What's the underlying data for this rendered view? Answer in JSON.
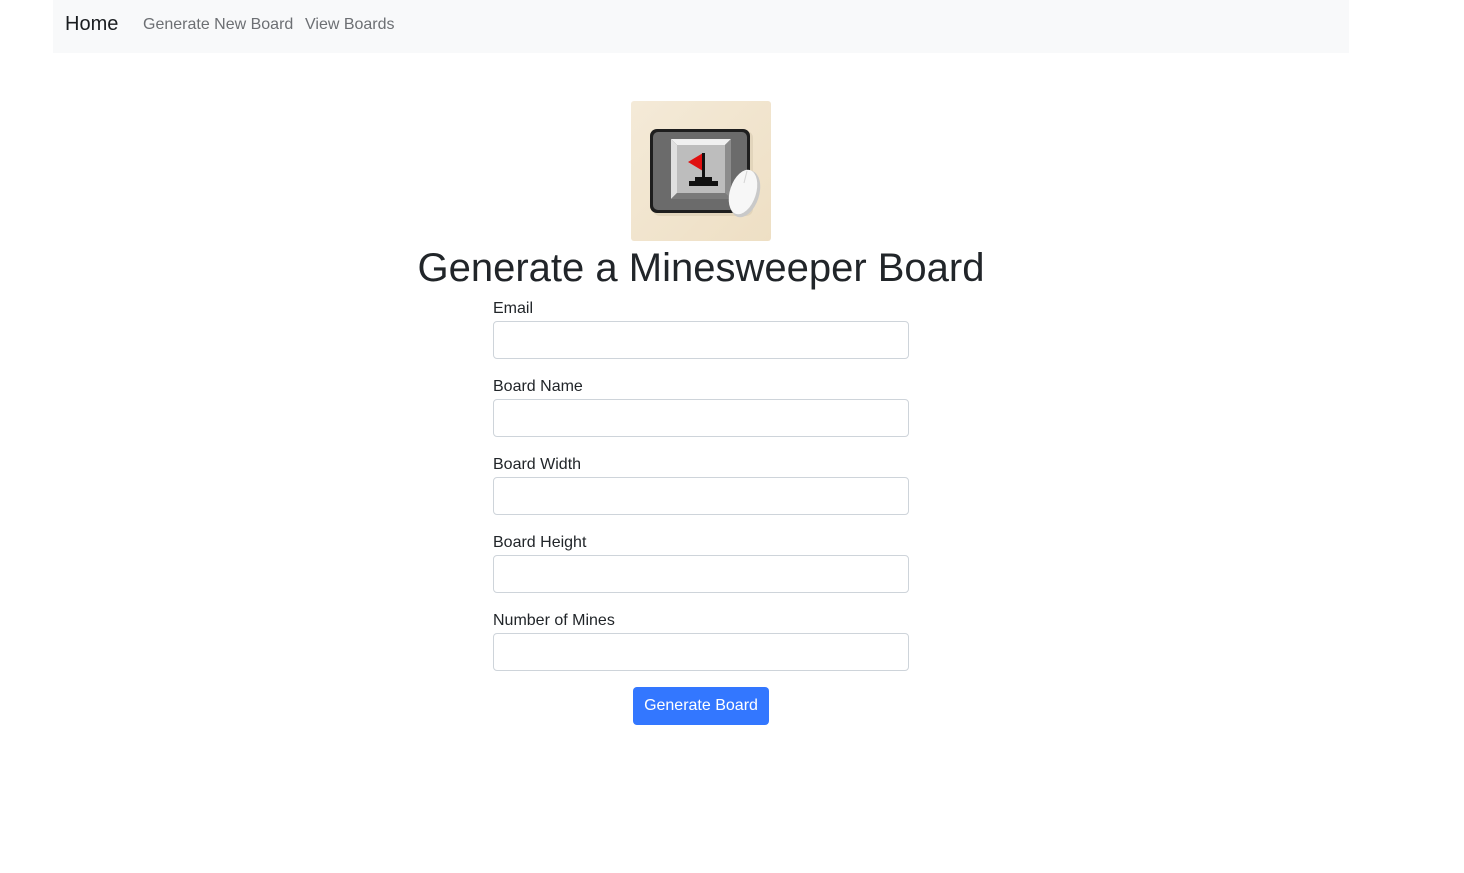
{
  "nav": {
    "brand": "Home",
    "links": [
      "Generate New Board",
      "View Boards"
    ]
  },
  "logo": {
    "icon": "minesweeper-flag-mousepad-icon"
  },
  "page": {
    "title": "Generate a Minesweeper Board"
  },
  "form": {
    "fields": [
      {
        "label": "Email",
        "value": "",
        "placeholder": ""
      },
      {
        "label": "Board Name",
        "value": "",
        "placeholder": ""
      },
      {
        "label": "Board Width",
        "value": "",
        "placeholder": ""
      },
      {
        "label": "Board Height",
        "value": "",
        "placeholder": ""
      },
      {
        "label": "Number of Mines",
        "value": "",
        "placeholder": ""
      }
    ],
    "submit_label": "Generate Board"
  },
  "colors": {
    "navbar_bg": "#f8f9fa",
    "primary_button": "#3377ff",
    "logo_bg": "#f2e6cf",
    "flag": "#e01010"
  }
}
